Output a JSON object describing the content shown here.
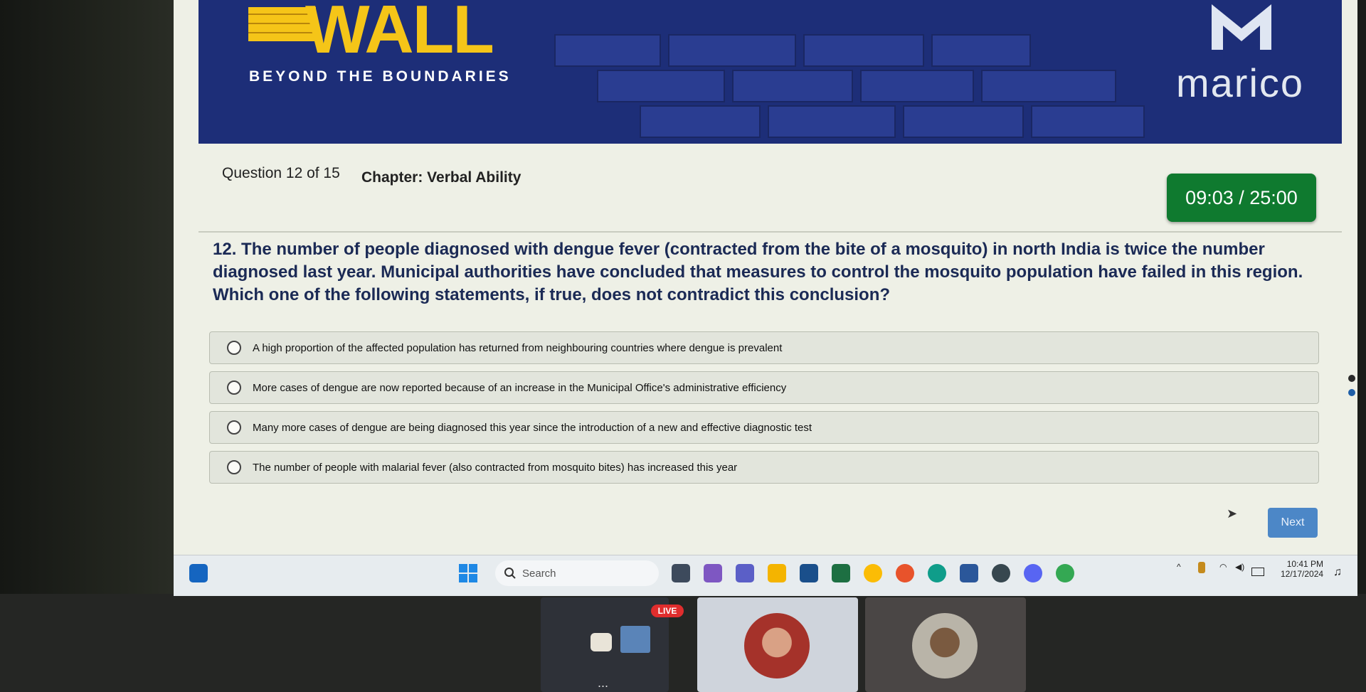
{
  "banner": {
    "logo_text": "WALL",
    "tagline": "BEYOND THE BOUNDARIES",
    "brand_name": "marico"
  },
  "quiz": {
    "progress": "Question 12 of 15",
    "chapter": "Chapter: Verbal Ability",
    "timer": "09:03 / 25:00",
    "question": "12. The number of people diagnosed with dengue fever (contracted from the bite of a mosquito) in north India is twice the number diagnosed last year. Municipal authorities have concluded that measures to control the mosquito population have failed in this region. Which one of the following statements, if true, does not contradict this conclusion?",
    "options": [
      "A high proportion of the affected population has returned from neighbouring countries where dengue is prevalent",
      "More cases of dengue are now reported because of an increase in the Municipal Office's administrative efficiency",
      "Many more cases of dengue are being diagnosed this year since the introduction of a new and effective diagnostic test",
      "The number of people with malarial fever (also contracted from mosquito bites) has increased this year"
    ],
    "selected_option": null,
    "next_label": "Next"
  },
  "taskbar": {
    "search_label": "Search",
    "time": "10:41 PM",
    "date": "12/17/2024"
  },
  "call": {
    "live_badge": "LIVE",
    "more": "..."
  },
  "colors": {
    "banner": "#1d2e78",
    "timer_bg": "#0f7a2f",
    "next_button": "#4c87c7",
    "question_text": "#1b2a55"
  }
}
